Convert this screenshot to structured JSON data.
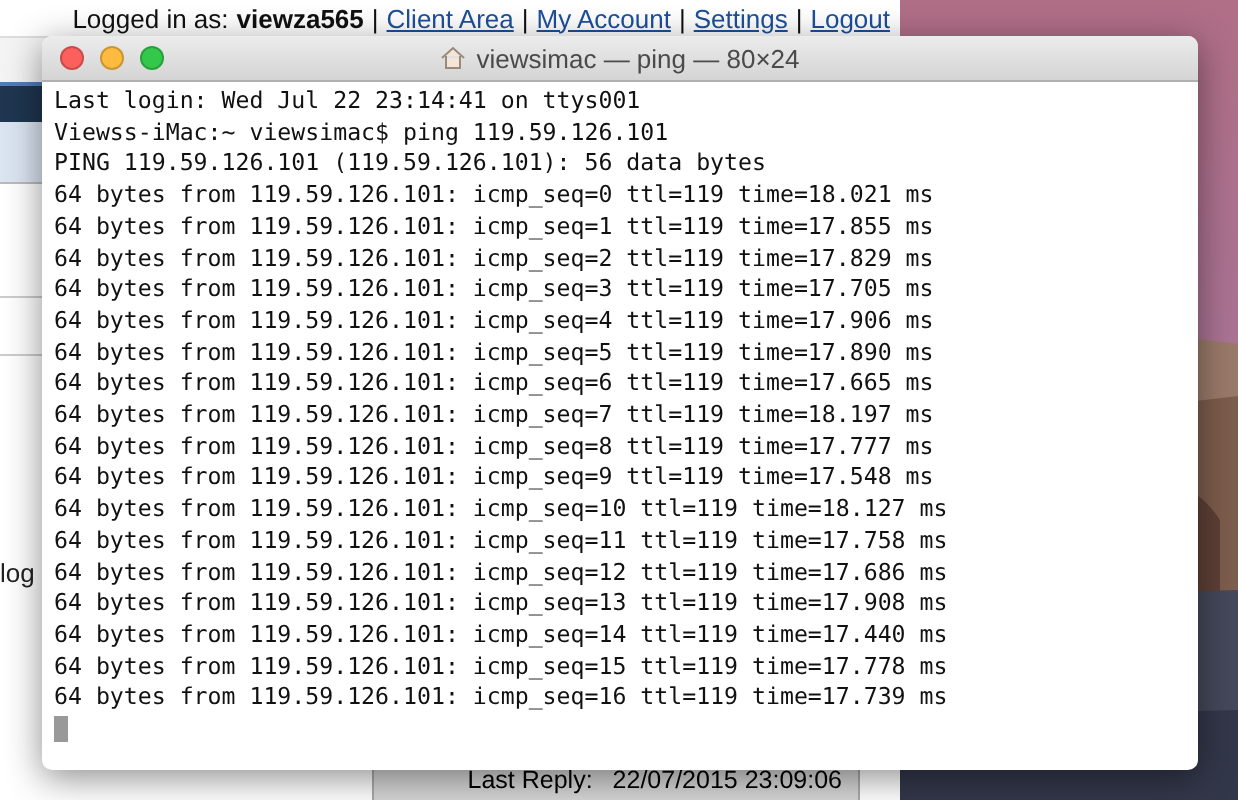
{
  "browser": {
    "user_label": "Logged in as:",
    "username": "viewza565",
    "separator": "|",
    "links": [
      "Client Area",
      "My Account",
      "Settings",
      "Logout"
    ],
    "fragment": "log",
    "reply_label": "Last Reply:",
    "reply_value": "22/07/2015 23:09:06"
  },
  "terminal": {
    "title": "viewsimac — ping — 80×24",
    "lines": [
      "Last login: Wed Jul 22 23:14:41 on ttys001",
      "Viewss-iMac:~ viewsimac$ ping 119.59.126.101",
      "PING 119.59.126.101 (119.59.126.101): 56 data bytes",
      "64 bytes from 119.59.126.101: icmp_seq=0 ttl=119 time=18.021 ms",
      "64 bytes from 119.59.126.101: icmp_seq=1 ttl=119 time=17.855 ms",
      "64 bytes from 119.59.126.101: icmp_seq=2 ttl=119 time=17.829 ms",
      "64 bytes from 119.59.126.101: icmp_seq=3 ttl=119 time=17.705 ms",
      "64 bytes from 119.59.126.101: icmp_seq=4 ttl=119 time=17.906 ms",
      "64 bytes from 119.59.126.101: icmp_seq=5 ttl=119 time=17.890 ms",
      "64 bytes from 119.59.126.101: icmp_seq=6 ttl=119 time=17.665 ms",
      "64 bytes from 119.59.126.101: icmp_seq=7 ttl=119 time=18.197 ms",
      "64 bytes from 119.59.126.101: icmp_seq=8 ttl=119 time=17.777 ms",
      "64 bytes from 119.59.126.101: icmp_seq=9 ttl=119 time=17.548 ms",
      "64 bytes from 119.59.126.101: icmp_seq=10 ttl=119 time=18.127 ms",
      "64 bytes from 119.59.126.101: icmp_seq=11 ttl=119 time=17.758 ms",
      "64 bytes from 119.59.126.101: icmp_seq=12 ttl=119 time=17.686 ms",
      "64 bytes from 119.59.126.101: icmp_seq=13 ttl=119 time=17.908 ms",
      "64 bytes from 119.59.126.101: icmp_seq=14 ttl=119 time=17.440 ms",
      "64 bytes from 119.59.126.101: icmp_seq=15 ttl=119 time=17.778 ms",
      "64 bytes from 119.59.126.101: icmp_seq=16 ttl=119 time=17.739 ms"
    ]
  }
}
